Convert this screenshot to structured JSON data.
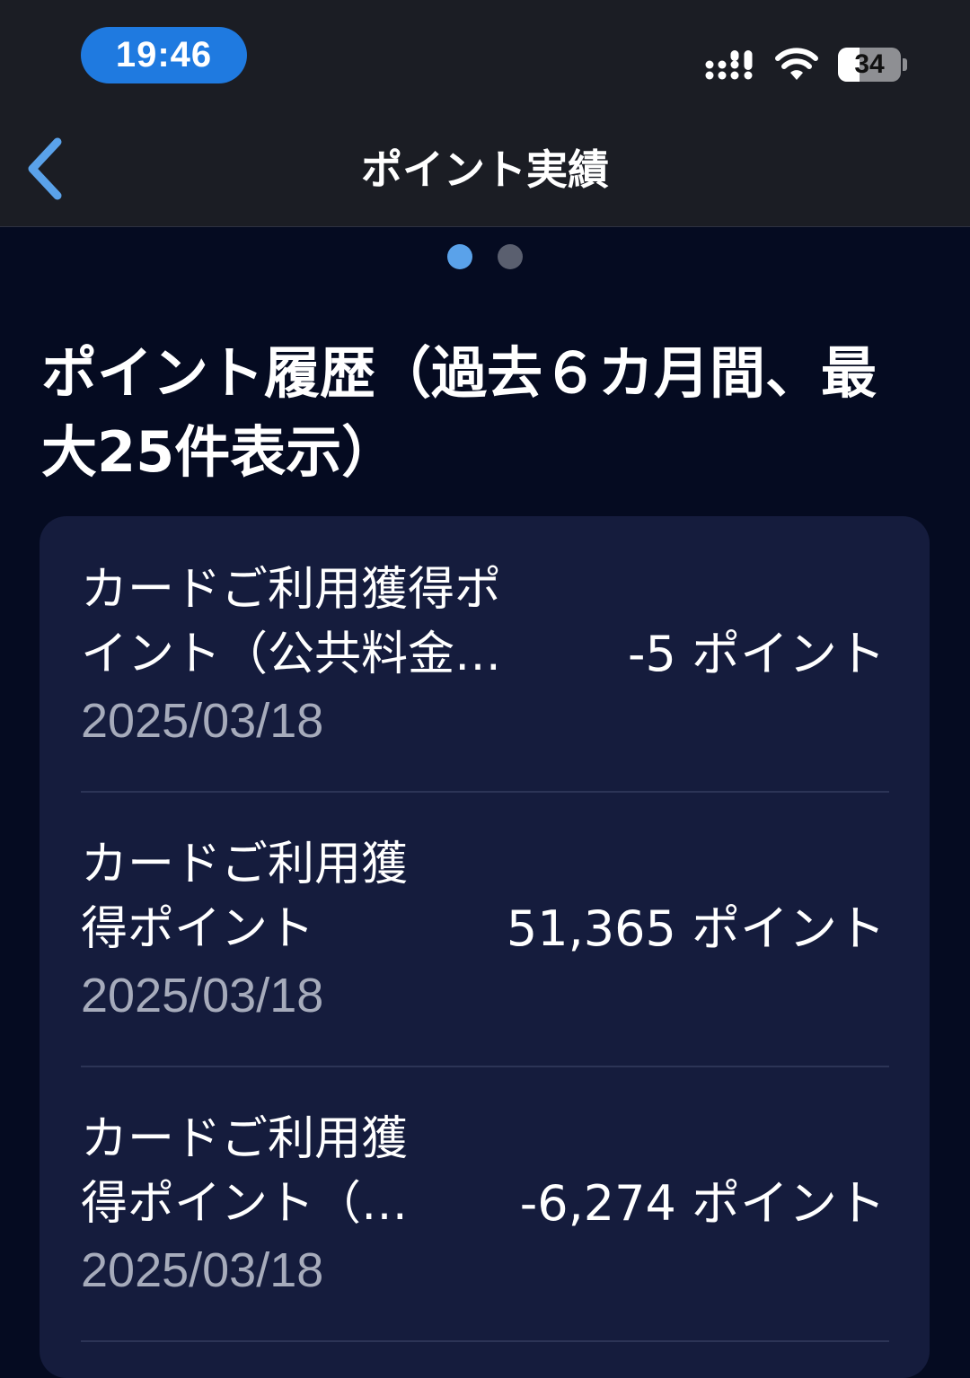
{
  "status_bar": {
    "time": "19:46",
    "battery_percent": "34",
    "icons": [
      "signal-icon",
      "wifi-icon",
      "battery-icon"
    ]
  },
  "nav": {
    "title": "ポイント実績",
    "back_icon": "chevron-left-icon"
  },
  "pager": {
    "page_count": 2,
    "active_index": 0
  },
  "section": {
    "title": "ポイント履歴（過去６カ月間、最大25件表示）"
  },
  "history": [
    {
      "label": "カードご利用獲得ポ\nイント（公共料金…",
      "amount": "-5 ポイント",
      "date": "2025/03/18"
    },
    {
      "label": "カードご利用獲\n得ポイント",
      "amount": "51,365 ポイント",
      "date": "2025/03/18"
    },
    {
      "label": "カードご利用獲\n得ポイント（…",
      "amount": "-6,274 ポイント",
      "date": "2025/03/18"
    }
  ],
  "colors": {
    "background": "#050b21",
    "bar": "#1b1d24",
    "card": "#151c3d",
    "accent": "#1f7ae0",
    "back_chevron": "#5aa2ea",
    "date_text": "#a6abbb"
  }
}
